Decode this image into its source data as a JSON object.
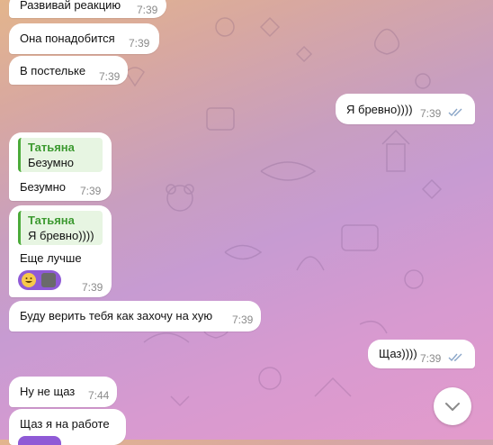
{
  "colors": {
    "bubble_bg": "#ffffff",
    "time_text": "#8a8a8a",
    "quote_accent": "#4cab3a",
    "quote_author": "#3d9a31",
    "quote_bg": "#e7f5e2",
    "read_ticks": "#8aa6c8",
    "reaction_bg": "#8f5ad6"
  },
  "messages": [
    {
      "text": "Развивай реакцию",
      "time": "7:39",
      "direction": "incoming"
    },
    {
      "text": "Она понадобится",
      "time": "7:39",
      "direction": "incoming"
    },
    {
      "text": "В постельке",
      "time": "7:39",
      "direction": "incoming"
    },
    {
      "text": "Я бревно))))",
      "time": "7:39",
      "direction": "outgoing",
      "status": "read"
    },
    {
      "reply": {
        "author": "Татьяна",
        "text": "Безумно"
      },
      "text": "Безумно",
      "time": "7:39",
      "direction": "incoming"
    },
    {
      "reply": {
        "author": "Татьяна",
        "text": "Я бревно))))"
      },
      "text": "Еще лучше",
      "time": "7:39",
      "direction": "incoming",
      "reactions": [
        "grinning-emoji",
        "user-avatar"
      ]
    },
    {
      "text": "Буду верить тебя как захочу на хую",
      "time": "7:39",
      "direction": "incoming"
    },
    {
      "text": "Щаз))))",
      "time": "7:39",
      "direction": "outgoing",
      "status": "read"
    },
    {
      "text": "Ну не щаз",
      "time": "7:44",
      "direction": "incoming"
    },
    {
      "text": "Щаз я на работе",
      "time": "",
      "direction": "incoming"
    }
  ],
  "scroll_button": {
    "icon": "chevron-down-icon"
  }
}
